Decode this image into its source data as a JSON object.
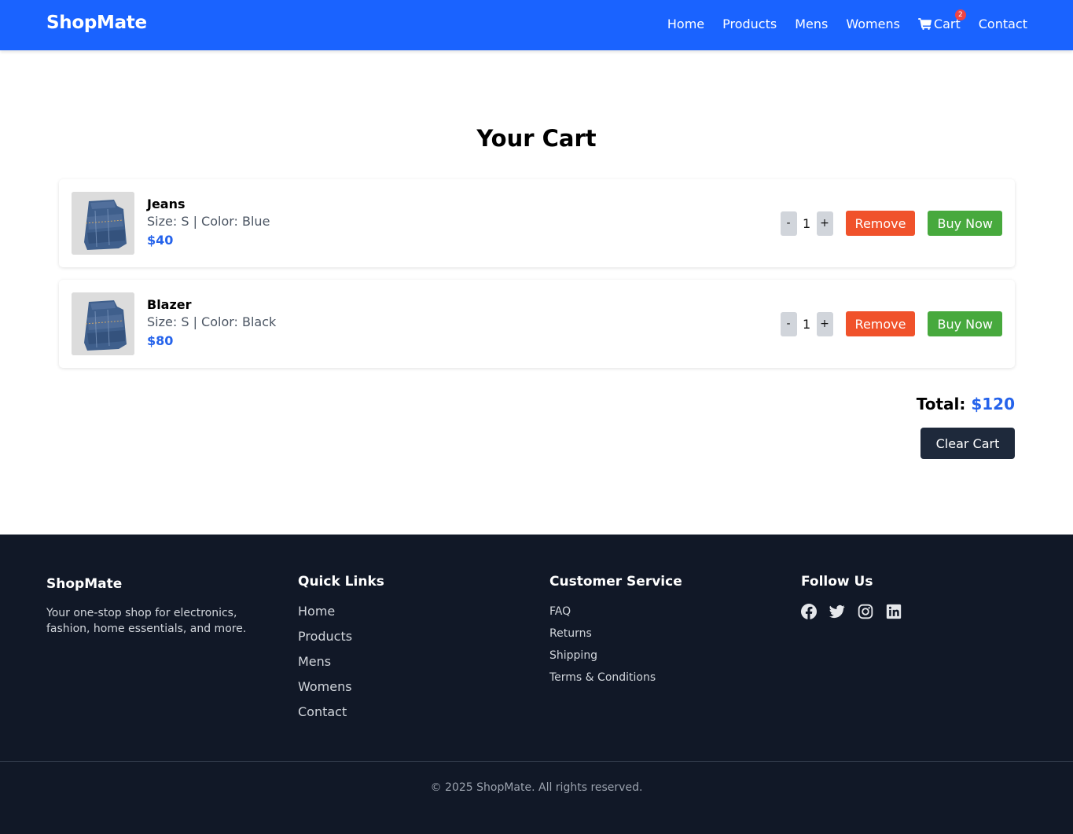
{
  "header": {
    "brand": "ShopMate",
    "nav": {
      "home": "Home",
      "products": "Products",
      "mens": "Mens",
      "womens": "Womens",
      "cart": "Cart",
      "cart_count": "2",
      "contact": "Contact"
    },
    "cart_icon": "shopping-cart-icon"
  },
  "main": {
    "title": "Your Cart",
    "items": [
      {
        "name": "Jeans",
        "meta": "Size: S | Color: Blue",
        "price": "$40",
        "qty": "1",
        "minus": "-",
        "plus": "+",
        "remove": "Remove",
        "buy": "Buy Now",
        "image": "jeans-image"
      },
      {
        "name": "Blazer",
        "meta": "Size: S | Color: Black",
        "price": "$80",
        "qty": "1",
        "minus": "-",
        "plus": "+",
        "remove": "Remove",
        "buy": "Buy Now",
        "image": "jeans-image"
      }
    ],
    "total_label": "Total:",
    "total_value": "$120",
    "clear_cart": "Clear Cart"
  },
  "footer": {
    "about": {
      "title": "ShopMate",
      "text": "Your one-stop shop for electronics, fashion, home essentials, and more."
    },
    "quick_links": {
      "title": "Quick Links",
      "items": [
        "Home",
        "Products",
        "Mens",
        "Womens",
        "Contact"
      ]
    },
    "customer_service": {
      "title": "Customer Service",
      "items": [
        "FAQ",
        "Returns",
        "Shipping",
        "Terms & Conditions"
      ]
    },
    "follow": {
      "title": "Follow Us",
      "icons": [
        "facebook-icon",
        "twitter-icon",
        "instagram-icon",
        "linkedin-icon"
      ]
    },
    "copyright": "© 2025 ShopMate. All rights reserved."
  },
  "colors": {
    "primary": "#1a63ff",
    "price": "#2563eb",
    "remove": "#f0522b",
    "buy": "#47a93d",
    "footer_bg": "#111827",
    "clear_button": "#1e293b"
  }
}
